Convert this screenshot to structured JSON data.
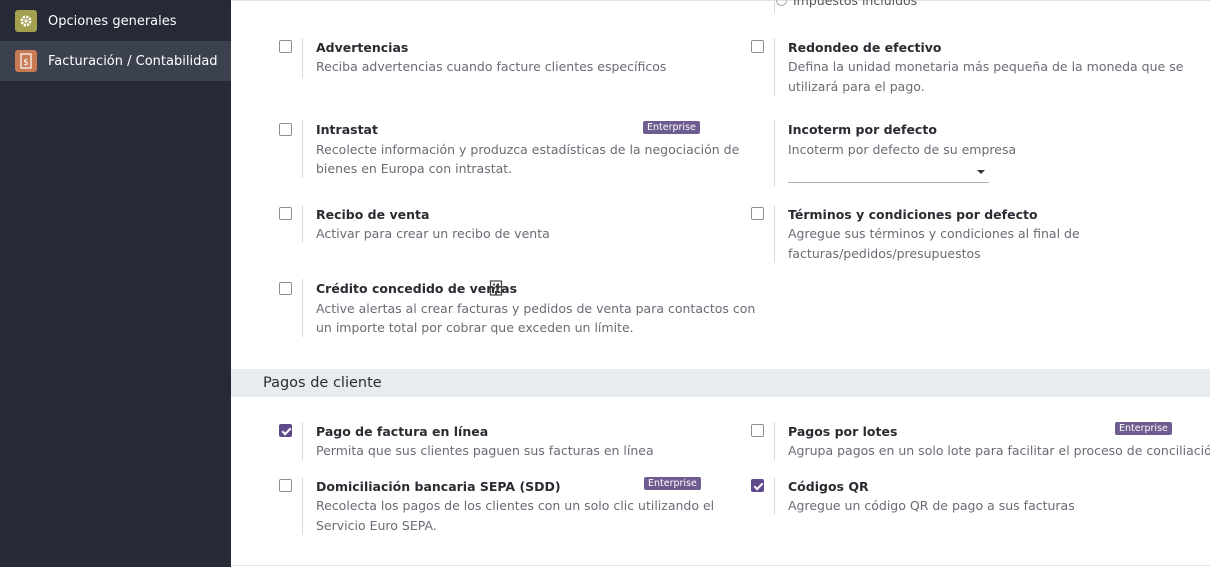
{
  "sidebar": {
    "items": [
      {
        "label": "Opciones generales",
        "icon": "gear-icon"
      },
      {
        "label": "Facturación / Contabilidad",
        "icon": "invoice-icon"
      }
    ]
  },
  "partial_top": {
    "label": "Impuestos incluidos"
  },
  "settings": {
    "advertencias": {
      "title": "Advertencias",
      "desc": "Reciba advertencias cuando facture clientes específicos",
      "checked": false
    },
    "redondeo": {
      "title": "Redondeo de efectivo",
      "desc1": "Defina la unidad monetaria más pequeña de la moneda que se",
      "desc2": "utilizará para el pago.",
      "checked": false
    },
    "intrastat": {
      "title": "Intrastat",
      "badge": "Enterprise",
      "desc1": "Recolecte información y produzca estadísticas de la negociación de",
      "desc2": "bienes en Europa con intrastat.",
      "checked": false
    },
    "incoterm": {
      "title": "Incoterm por defecto",
      "desc": "Incoterm por defecto de su empresa"
    },
    "recibo": {
      "title": "Recibo de venta",
      "desc": "Activar para crear un recibo de venta",
      "checked": false
    },
    "terminos": {
      "title": "Términos y condiciones por defecto",
      "desc1": "Agregue sus términos y condiciones al final de",
      "desc2": "facturas/pedidos/presupuestos",
      "checked": false
    },
    "credito": {
      "title": "Crédito concedido de ventas",
      "desc1": "Active alertas al crear facturas y pedidos de venta para contactos con",
      "desc2": "un importe total por cobrar que exceden un límite.",
      "checked": false
    }
  },
  "section": {
    "title": "Pagos de cliente"
  },
  "payments": {
    "pago_linea": {
      "title": "Pago de factura en línea",
      "desc": "Permita que sus clientes paguen sus facturas en línea",
      "checked": true
    },
    "lotes": {
      "title": "Pagos por lotes",
      "badge": "Enterprise",
      "desc": "Agrupa pagos en un solo lote para facilitar el proceso de conciliación",
      "checked": false
    },
    "sepa": {
      "title": "Domiciliación bancaria SEPA (SDD)",
      "badge": "Enterprise",
      "desc1": "Recolecta los pagos de los clientes con un solo clic utilizando el",
      "desc2": "Servicio Euro SEPA.",
      "checked": false
    },
    "qr": {
      "title": "Códigos QR",
      "desc": "Agregue un código QR de pago a sus facturas",
      "checked": true
    }
  },
  "colors": {
    "sidebar_bg": "#262a36",
    "active_item": "#3c4150",
    "accent": "#5f4b8b",
    "badge": "#6e5b8f"
  }
}
